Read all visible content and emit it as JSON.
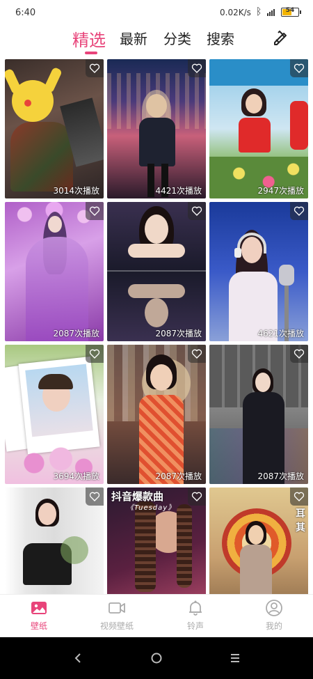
{
  "status_bar": {
    "time": "6:40",
    "speed": "0.02K/s",
    "battery": "54",
    "signal_label": "4G"
  },
  "top_tabs": [
    {
      "label": "精选",
      "active": true
    },
    {
      "label": "最新",
      "active": false
    },
    {
      "label": "分类",
      "active": false
    },
    {
      "label": "搜索",
      "active": false
    }
  ],
  "wallpapers": [
    {
      "plays": "3014次播放",
      "theme": "pikachu-cartoon"
    },
    {
      "plays": "4421次播放",
      "theme": "cyberpunk-city-girl"
    },
    {
      "plays": "2947次播放",
      "theme": "woman-red-dress-flowers"
    },
    {
      "plays": "2087次播放",
      "theme": "purple-fairy"
    },
    {
      "plays": "2087次播放",
      "theme": "woman-mirror-reflection"
    },
    {
      "plays": "4621次播放",
      "theme": "girl-headphones-mic"
    },
    {
      "plays": "3694次播放",
      "theme": "girl-polaroid-bubbles"
    },
    {
      "plays": "2087次播放",
      "theme": "girl-orange-dress"
    },
    {
      "plays": "2087次播放",
      "theme": "woman-black-urban"
    },
    {
      "plays": "",
      "theme": "woman-black-top-curtains"
    },
    {
      "plays": "",
      "theme": "woman-braids-music",
      "title": "抖音爆款曲",
      "subtitle": "《Tuesday》"
    },
    {
      "plays": "",
      "theme": "woman-hot-air-balloon",
      "side_text": "耳其"
    }
  ],
  "bottom_nav": [
    {
      "label": "壁纸",
      "icon": "image-icon",
      "active": true
    },
    {
      "label": "视频壁纸",
      "icon": "video-icon",
      "active": false
    },
    {
      "label": "铃声",
      "icon": "bell-icon",
      "active": false
    },
    {
      "label": "我的",
      "icon": "user-icon",
      "active": false
    }
  ],
  "colors": {
    "accent": "#e8447a"
  }
}
